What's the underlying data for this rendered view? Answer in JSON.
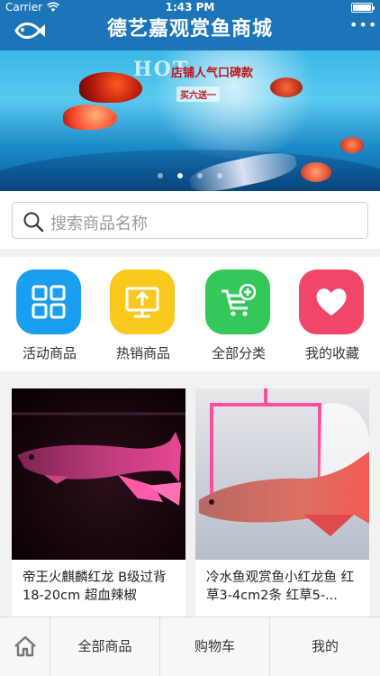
{
  "status_bar": {
    "carrier": "Carrier",
    "time": "1:43 PM"
  },
  "header": {
    "title": "德艺嘉观赏鱼商城",
    "logo_icon": "fish-logo-icon",
    "more_icon": "more-dots-icon",
    "more_glyph": "•••"
  },
  "banner": {
    "hot_text": "HOT",
    "slogan": "店铺人气口碑款",
    "promo": "买六送一",
    "slide_count": 4,
    "active_slide": 2
  },
  "search": {
    "placeholder": "搜索商品名称",
    "icon": "search-icon"
  },
  "categories": [
    {
      "label": "活动商品",
      "icon": "grid-icon",
      "color": "#1a9ff0"
    },
    {
      "label": "热销商品",
      "icon": "monitor-upload-icon",
      "color": "#f9c91e"
    },
    {
      "label": "全部分类",
      "icon": "cart-add-icon",
      "color": "#34c759"
    },
    {
      "label": "我的收藏",
      "icon": "heart-icon",
      "color": "#f2456a"
    }
  ],
  "products": [
    {
      "name": "帝王火麒麟红龙 B级过背18-20cm 超血辣椒"
    },
    {
      "name": "冷水鱼观赏鱼小红龙鱼 红草3-4cm2条 红草5-..."
    }
  ],
  "tabbar": {
    "home_icon": "home-icon",
    "items": [
      "全部商品",
      "购物车",
      "我的"
    ]
  },
  "colors": {
    "primary": "#1d75b9",
    "background": "#f2f2f2"
  }
}
